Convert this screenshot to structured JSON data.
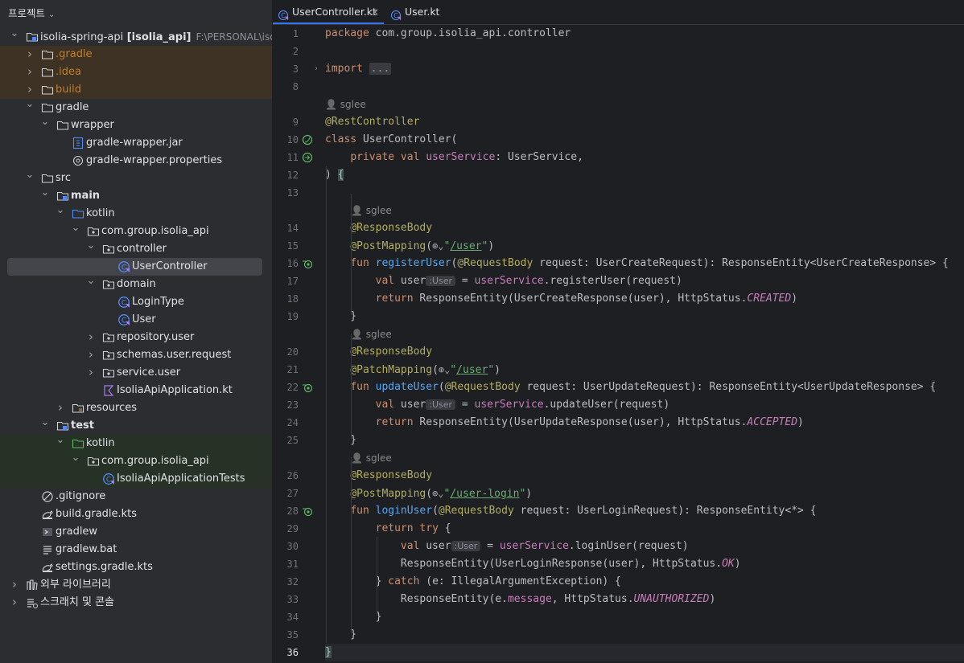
{
  "project_panel": {
    "title": "프로젝트",
    "tree": [
      {
        "label": "isolia-spring-api",
        "module": "[isolia_api]",
        "path": "F:\\PERSONAL\\isoli",
        "level": 0,
        "state": "open",
        "icon": "module-folder-icon"
      },
      {
        "label": ".gradle",
        "level": 1,
        "state": "closed",
        "icon": "folder-icon",
        "style": "excluded"
      },
      {
        "label": ".idea",
        "level": 1,
        "state": "closed",
        "icon": "folder-icon",
        "style": "excluded"
      },
      {
        "label": "build",
        "level": 1,
        "state": "closed",
        "icon": "folder-icon",
        "style": "excluded"
      },
      {
        "label": "gradle",
        "level": 1,
        "state": "open",
        "icon": "folder-icon"
      },
      {
        "label": "wrapper",
        "level": 2,
        "state": "open",
        "icon": "folder-icon"
      },
      {
        "label": "gradle-wrapper.jar",
        "level": 3,
        "state": "none",
        "icon": "jar-icon"
      },
      {
        "label": "gradle-wrapper.properties",
        "level": 3,
        "state": "none",
        "icon": "settings-file-icon"
      },
      {
        "label": "src",
        "level": 1,
        "state": "open",
        "icon": "folder-icon"
      },
      {
        "label": "main",
        "level": 2,
        "state": "open",
        "icon": "source-root-icon",
        "bold": true
      },
      {
        "label": "kotlin",
        "level": 3,
        "state": "open",
        "icon": "blue-folder-icon"
      },
      {
        "label": "com.group.isolia_api",
        "level": 4,
        "state": "open",
        "icon": "package-icon"
      },
      {
        "label": "controller",
        "level": 5,
        "state": "open",
        "icon": "package-icon"
      },
      {
        "label": "UserController",
        "level": 6,
        "state": "none",
        "icon": "kotlin-class-icon",
        "selected": true
      },
      {
        "label": "domain",
        "level": 5,
        "state": "open",
        "icon": "package-icon"
      },
      {
        "label": "LoginType",
        "level": 6,
        "state": "none",
        "icon": "kotlin-class-icon"
      },
      {
        "label": "User",
        "level": 6,
        "state": "none",
        "icon": "kotlin-class-icon"
      },
      {
        "label": "repository.user",
        "level": 5,
        "state": "closed",
        "icon": "package-icon"
      },
      {
        "label": "schemas.user.request",
        "level": 5,
        "state": "closed",
        "icon": "package-icon"
      },
      {
        "label": "service.user",
        "level": 5,
        "state": "closed",
        "icon": "package-icon"
      },
      {
        "label": "IsoliaApiApplication.kt",
        "level": 5,
        "state": "none",
        "icon": "kotlin-file-icon"
      },
      {
        "label": "resources",
        "level": 3,
        "state": "closed",
        "icon": "resources-folder-icon"
      },
      {
        "label": "test",
        "level": 2,
        "state": "open",
        "icon": "source-root-icon",
        "bold": true
      },
      {
        "label": "kotlin",
        "level": 3,
        "state": "open",
        "icon": "green-folder-icon",
        "style": "test"
      },
      {
        "label": "com.group.isolia_api",
        "level": 4,
        "state": "open",
        "icon": "package-icon",
        "style": "test"
      },
      {
        "label": "IsoliaApiApplicationTests",
        "level": 5,
        "state": "none",
        "icon": "kotlin-test-class-icon",
        "style": "test"
      },
      {
        "label": ".gitignore",
        "level": 1,
        "state": "none",
        "icon": "ignore-file-icon"
      },
      {
        "label": "build.gradle.kts",
        "level": 1,
        "state": "none",
        "icon": "gradle-icon"
      },
      {
        "label": "gradlew",
        "level": 1,
        "state": "none",
        "icon": "shell-script-icon"
      },
      {
        "label": "gradlew.bat",
        "level": 1,
        "state": "none",
        "icon": "text-file-icon"
      },
      {
        "label": "settings.gradle.kts",
        "level": 1,
        "state": "none",
        "icon": "gradle-icon"
      },
      {
        "label": "외부 라이브러리",
        "level": 0,
        "state": "closed",
        "icon": "library-icon"
      },
      {
        "label": "스크래치 및 콘솔",
        "level": 0,
        "state": "closed",
        "icon": "scratch-icon"
      }
    ]
  },
  "editor": {
    "tabs": [
      {
        "label": "UserController.kt",
        "active": true,
        "close": "×"
      },
      {
        "label": "User.kt",
        "active": false
      }
    ],
    "current_line": "36",
    "lines": [
      {
        "n": "1",
        "html": "<span class='kw'>package</span> com.group.isolia_api.controller"
      },
      {
        "n": "2",
        "html": ""
      },
      {
        "n": "3",
        "html": "<span class='kw'>import</span> <span class='ellip'>...</span>",
        "fold": "›"
      },
      {
        "n": "8",
        "html": ""
      },
      {
        "author": "sglee",
        "indent": 0
      },
      {
        "n": "9",
        "html": "<span class='ann'>@RestController</span>"
      },
      {
        "n": "10",
        "html": "<span class='kw'>class</span> UserController(",
        "gicon": "bean-icon"
      },
      {
        "n": "11",
        "html": "    <span class='kw'>private val</span> <span class='prop'>userService</span>: UserService,",
        "gicon": "injection-icon"
      },
      {
        "n": "12",
        "html": ") <span class='brace-hl'>{</span>"
      },
      {
        "n": "13",
        "html": ""
      },
      {
        "author": "sglee",
        "indent": 1
      },
      {
        "n": "14",
        "html": "    <span class='ann'>@ResponseBody</span>"
      },
      {
        "n": "15",
        "html": "    <span class='ann'>@PostMapping</span>(<span class='globe'>⊕⌄</span><span class='str'>\"<u>/user</u>\"</span>)"
      },
      {
        "n": "16",
        "html": "    <span class='kw'>fun</span> <span class='fn'>registerUser</span>(<span class='ann'>@RequestBody</span> request: UserCreateRequest): ResponseEntity&lt;UserCreateResponse&gt; {",
        "gicon": "endpoint-icon"
      },
      {
        "n": "17",
        "html": "        <span class='kw'>val</span> user<span class='hintbox'>:User</span> = <span class='prop'>userService</span>.registerUser(request)"
      },
      {
        "n": "18",
        "html": "        <span class='kw'>return</span> ResponseEntity(UserCreateResponse(user), HttpStatus.<span class='const'>CREATED</span>)"
      },
      {
        "n": "19",
        "html": "    }"
      },
      {
        "author": "sglee",
        "indent": 1
      },
      {
        "n": "20",
        "html": "    <span class='ann'>@ResponseBody</span>"
      },
      {
        "n": "21",
        "html": "    <span class='ann'>@PatchMapping</span>(<span class='globe'>⊕⌄</span><span class='str'>\"<u>/user</u>\"</span>)"
      },
      {
        "n": "22",
        "html": "    <span class='kw'>fun</span> <span class='fn'>updateUser</span>(<span class='ann'>@RequestBody</span> request: UserUpdateRequest): ResponseEntity&lt;UserUpdateResponse&gt; {",
        "gicon": "endpoint-icon"
      },
      {
        "n": "23",
        "html": "        <span class='kw'>val</span> user<span class='hintbox'>:User</span> = <span class='prop'>userService</span>.updateUser(request)"
      },
      {
        "n": "24",
        "html": "        <span class='kw'>return</span> ResponseEntity(UserUpdateResponse(user), HttpStatus.<span class='const'>ACCEPTED</span>)"
      },
      {
        "n": "25",
        "html": "    }"
      },
      {
        "author": "sglee",
        "indent": 1
      },
      {
        "n": "26",
        "html": "    <span class='ann'>@ResponseBody</span>"
      },
      {
        "n": "27",
        "html": "    <span class='ann'>@PostMapping</span>(<span class='globe'>⊕⌄</span><span class='str'>\"<u>/user-login</u>\"</span>)"
      },
      {
        "n": "28",
        "html": "    <span class='kw'>fun</span> <span class='fn'>loginUser</span>(<span class='ann'>@RequestBody</span> request: UserLoginRequest): ResponseEntity&lt;*&gt; {",
        "gicon": "endpoint-icon"
      },
      {
        "n": "29",
        "html": "        <span class='kw'>return try</span> {"
      },
      {
        "n": "30",
        "html": "            <span class='kw'>val</span> user<span class='hintbox'>:User</span> = <span class='prop'>userService</span>.loginUser(request)"
      },
      {
        "n": "31",
        "html": "            ResponseEntity(UserLoginResponse(user), HttpStatus.<span class='const'>OK</span>)"
      },
      {
        "n": "32",
        "html": "        } <span class='kw'>catch</span> (e: IllegalArgumentException) {"
      },
      {
        "n": "33",
        "html": "            ResponseEntity(e.<span class='prop'>message</span>, HttpStatus.<span class='const'>UNAUTHORIZED</span>)"
      },
      {
        "n": "34",
        "html": "        }"
      },
      {
        "n": "35",
        "html": "    }"
      },
      {
        "n": "36",
        "html": "<span class='brace-hl'>}</span>"
      }
    ]
  },
  "colors": {
    "accent": "#3574f0",
    "excluded_bg": "#3d3223",
    "test_bg": "#263226",
    "selected_bg": "#43454a"
  }
}
